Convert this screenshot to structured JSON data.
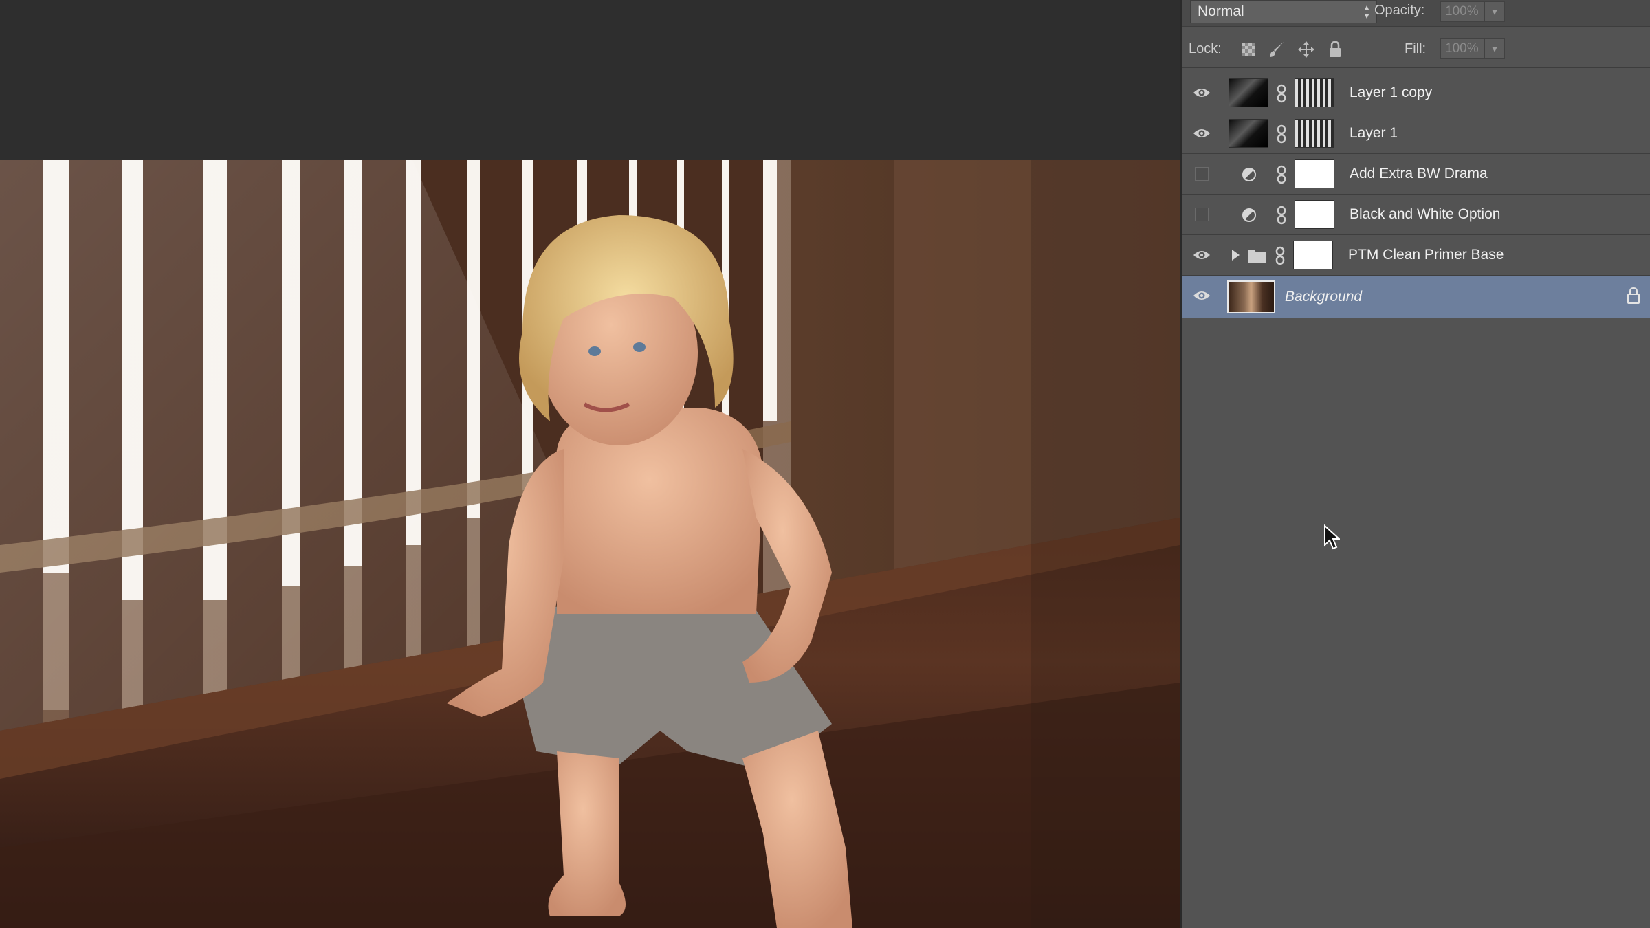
{
  "layers_panel": {
    "blend_mode": "Normal",
    "opacity_label": "Opacity:",
    "opacity_value": "100%",
    "lock_label": "Lock:",
    "fill_label": "Fill:",
    "fill_value": "100%",
    "layers": [
      {
        "name": "Layer 1 copy",
        "visible": true,
        "type": "pixel-with-mask"
      },
      {
        "name": "Layer 1",
        "visible": true,
        "type": "pixel-with-mask"
      },
      {
        "name": "Add Extra BW Drama",
        "visible": false,
        "type": "adjustment"
      },
      {
        "name": "Black and White Option",
        "visible": false,
        "type": "adjustment"
      },
      {
        "name": "PTM Clean Primer Base",
        "visible": true,
        "type": "group"
      },
      {
        "name": "Background",
        "visible": true,
        "type": "background",
        "selected": true,
        "locked": true
      }
    ]
  },
  "colors": {
    "panel_bg": "#535353",
    "selected_row": "#6d7f9d",
    "canvas_bg": "#2e2e2e"
  }
}
